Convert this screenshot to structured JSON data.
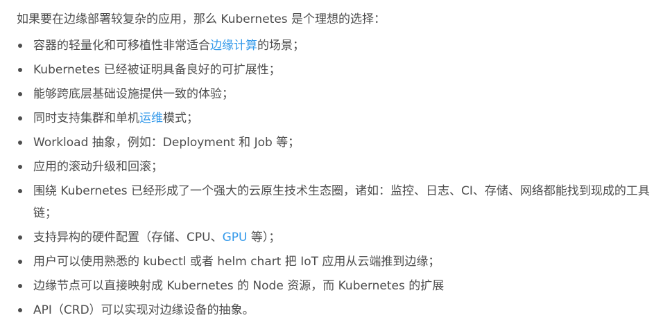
{
  "article": {
    "intro": "如果要在边缘部署较复杂的应用，那么 Kubernetes 是个理想的选择：",
    "items": [
      {
        "pre": "容器的轻量化和可移植性非常适合",
        "link": "边缘计算",
        "post": "的场景；"
      },
      {
        "text": "Kubernetes 已经被证明具备良好的可扩展性；"
      },
      {
        "text": "能够跨底层基础设施提供一致的体验；"
      },
      {
        "pre": "同时支持集群和单机",
        "link": "运维",
        "post": "模式；"
      },
      {
        "text": "Workload 抽象，例如：Deployment 和 Job 等；"
      },
      {
        "text": "应用的滚动升级和回滚；"
      },
      {
        "text": "围绕 Kubernetes 已经形成了一个强大的云原生技术生态圈，诸如：监控、日志、CI、存储、网络都能找到现成的工具链；"
      },
      {
        "pre": "支持异构的硬件配置（存储、CPU、",
        "link": "GPU",
        "post": " 等）；"
      },
      {
        "text": "用户可以使用熟悉的 kubectl 或者 helm chart 把 IoT 应用从云端推到边缘；"
      },
      {
        "text": "边缘节点可以直接映射成 Kubernetes 的 Node 资源，而 Kubernetes 的扩展"
      },
      {
        "text": "API（CRD）可以实现对边缘设备的抽象。"
      }
    ]
  },
  "colors": {
    "text": "#4d4d4d",
    "link": "#3399ea"
  }
}
